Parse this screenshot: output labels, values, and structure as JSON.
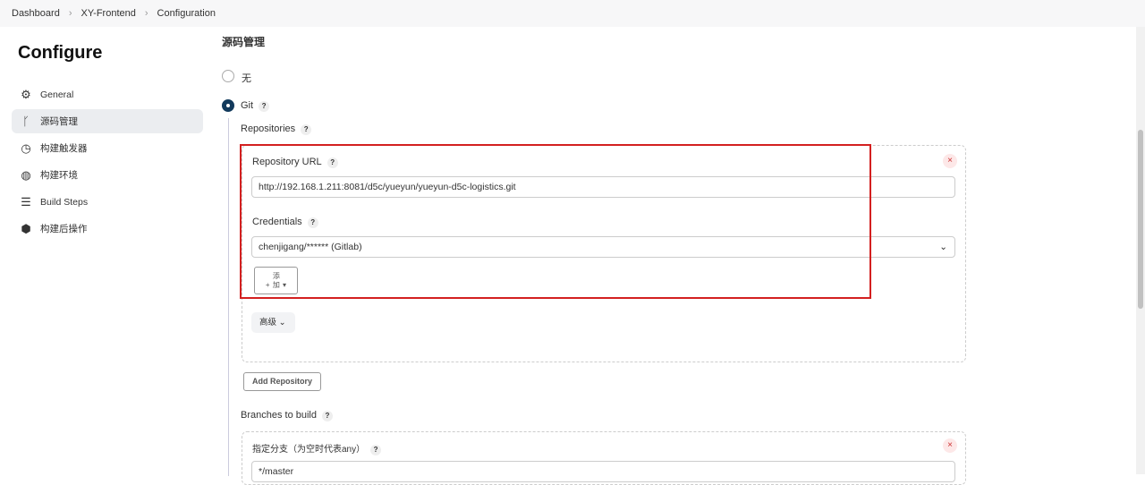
{
  "breadcrumb": [
    "Dashboard",
    "XY-Frontend",
    "Configuration"
  ],
  "title": "Configure",
  "sidebar": [
    {
      "label": "General",
      "icon": "gear-icon"
    },
    {
      "label": "源码管理",
      "icon": "branch-icon"
    },
    {
      "label": "构建触发器",
      "icon": "timer-icon"
    },
    {
      "label": "构建环境",
      "icon": "globe-icon"
    },
    {
      "label": "Build Steps",
      "icon": "list-icon"
    },
    {
      "label": "构建后操作",
      "icon": "package-icon"
    }
  ],
  "section": "源码管理",
  "scm": {
    "none": "无",
    "git": "Git",
    "repositories": "Repositories",
    "repo_url_label": "Repository URL",
    "repo_url": "http://192.168.1.211:8081/d5c/yueyun/yueyun-d5c-logistics.git",
    "credentials_label": "Credentials",
    "credentials": "chenjigang/****** (Gitlab)",
    "add": "添加",
    "advanced": "高级",
    "add_repo": "Add Repository",
    "branches": "Branches to build",
    "branch_label": "指定分支（为空时代表any）",
    "branch": "*/master"
  }
}
